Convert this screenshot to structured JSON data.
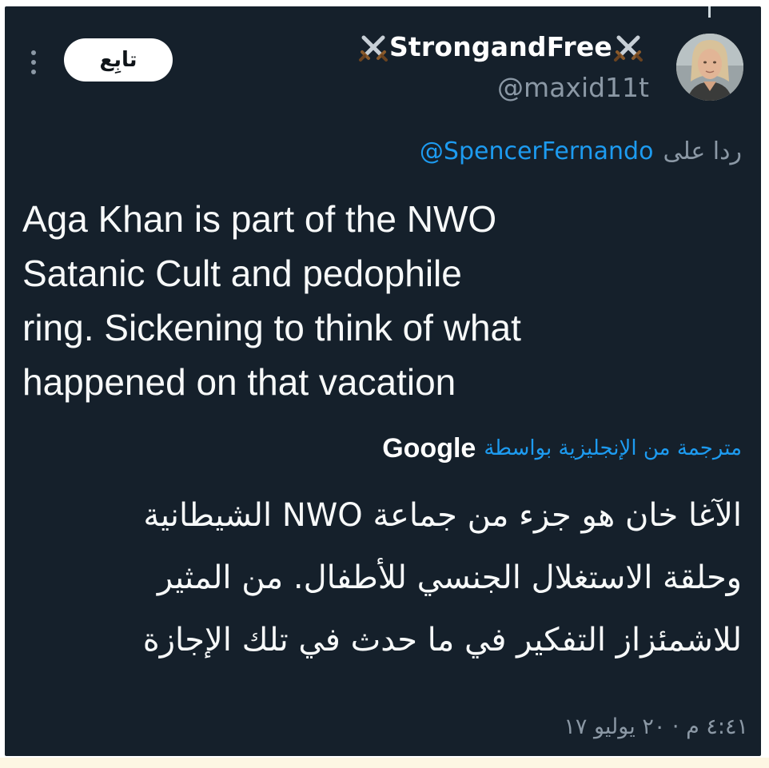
{
  "author": {
    "display_name": "StrongandFree",
    "handle": "@maxid11t",
    "name_icons": [
      "crossed-swords-icon",
      "crossed-swords-icon"
    ]
  },
  "actions": {
    "follow_label": "تابِع",
    "more_icon": "more-vertical-icon"
  },
  "reply": {
    "prefix": "ردا على",
    "to_handle": "@SpencerFernando"
  },
  "tweet": {
    "text": "Aga Khan is part of the NWO\nSatanic Cult and pedophile\nring. Sickening to think of what\nhappened on that vacation"
  },
  "translation": {
    "attribution": "مترجمة من الإنجليزية بواسطة",
    "provider": "Google",
    "text": "الآغا خان هو جزء من جماعة NWO الشيطانية\nوحلقة الاستغلال الجنسي للأطفال. من المثير\nللاشمئزاز التفكير في ما حدث في تلك الإجازة"
  },
  "meta": {
    "timestamp": "٤:٤١ م · ٢٠ يوليو ١٧"
  },
  "colors": {
    "background": "#15202b",
    "text": "#f7f9f9",
    "muted": "#8b98a5",
    "accent": "#1d9bf0"
  }
}
